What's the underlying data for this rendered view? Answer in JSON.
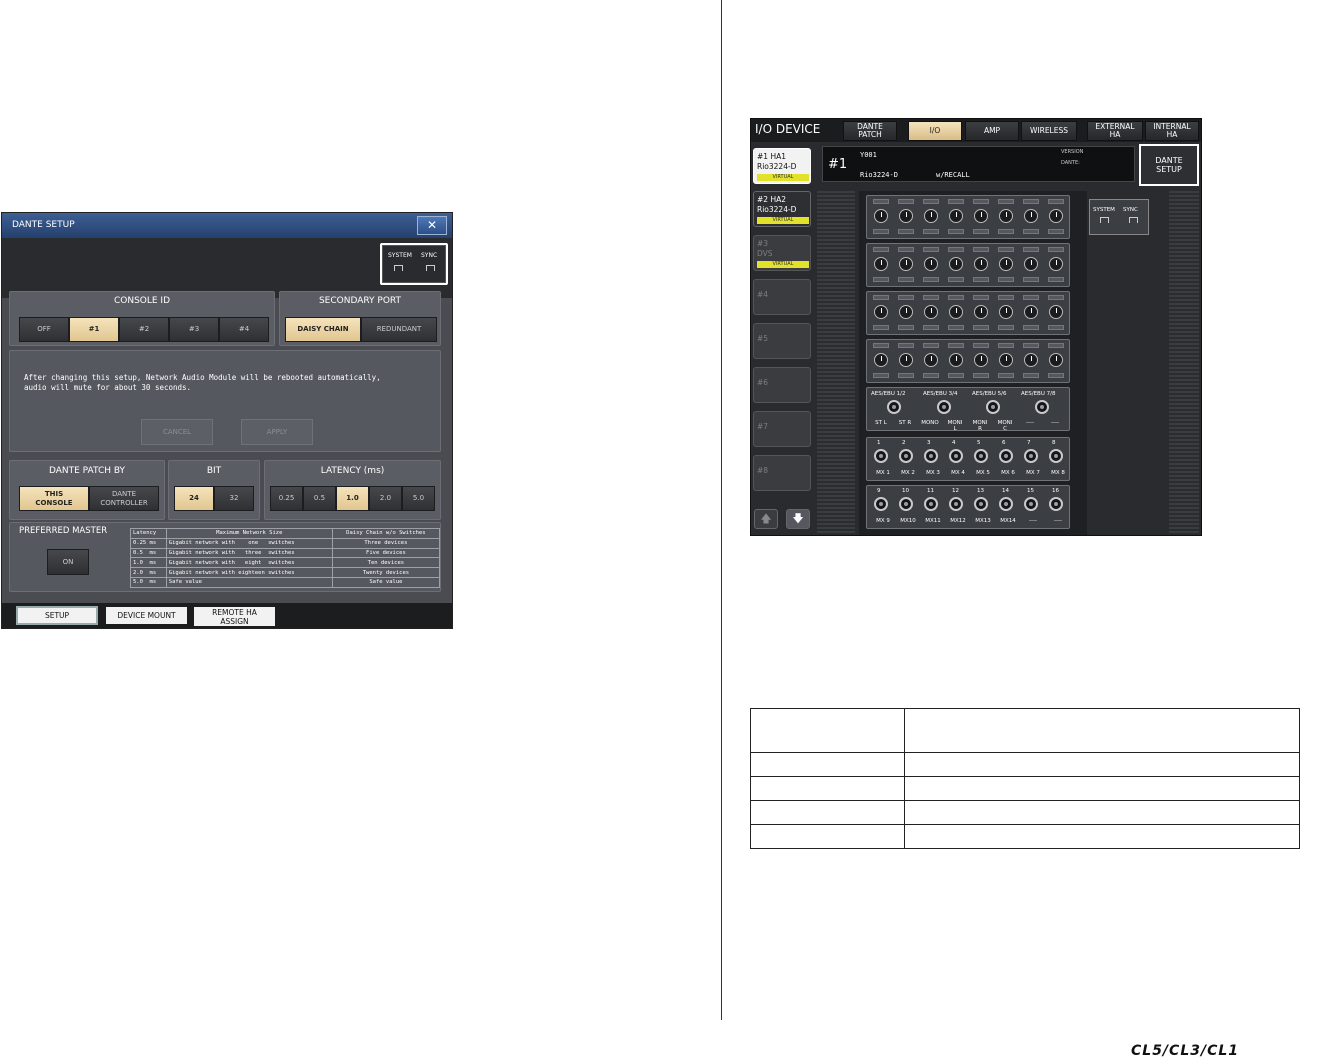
{
  "dante_setup": {
    "title": "DANTE SETUP",
    "close_symbol": "✕",
    "sync": {
      "system": "SYSTEM",
      "sync": "SYNC"
    },
    "console_id": {
      "title": "CONSOLE ID",
      "options": [
        "OFF",
        "#1",
        "#2",
        "#3",
        "#4"
      ],
      "selected": "#1"
    },
    "secondary_port": {
      "title": "SECONDARY PORT",
      "options": [
        "DAISY CHAIN",
        "REDUNDANT"
      ],
      "selected": "DAISY CHAIN"
    },
    "note": "After changing this setup, Network Audio Module will be rebooted automatically,\naudio will mute for about 30 seconds.",
    "cancel": "CANCEL",
    "apply": "APPLY",
    "dante_patch_by": {
      "title": "DANTE PATCH BY",
      "options": [
        "THIS\nCONSOLE",
        "DANTE\nCONTROLLER"
      ],
      "selected": "THIS\nCONSOLE"
    },
    "bit": {
      "title": "BIT",
      "options": [
        "24",
        "32"
      ],
      "selected": "24"
    },
    "latency": {
      "title": "LATENCY (ms)",
      "options": [
        "0.25",
        "0.5",
        "1.0",
        "2.0",
        "5.0"
      ],
      "selected": "1.0"
    },
    "preferred_master": {
      "title": "PREFERRED MASTER",
      "button": "ON"
    },
    "latency_table": {
      "headers": [
        "Latency",
        "Maximum Network Size",
        "Daisy Chain w/o Switches"
      ],
      "rows": [
        [
          "0.25 ms",
          "Gigabit network with    one   switches",
          "Three devices"
        ],
        [
          "0.5  ms",
          "Gigabit network with   three  switches",
          "Five devices"
        ],
        [
          "1.0  ms",
          "Gigabit network with   eight  switches",
          "Ten devices"
        ],
        [
          "2.0  ms",
          "Gigabit network with eighteen switches",
          "Twenty devices"
        ],
        [
          "5.0  ms",
          "Safe value",
          "Safe value"
        ]
      ]
    },
    "tabs": [
      "SETUP",
      "DEVICE MOUNT",
      "REMOTE HA\nASSIGN"
    ],
    "active_tab": "SETUP"
  },
  "io_device": {
    "title": "I/O DEVICE",
    "tabs": [
      "DANTE\nPATCH",
      "I/O",
      "AMP",
      "WIRELESS",
      "EXTERNAL\nHA",
      "INTERNAL\nHA"
    ],
    "active_tab": "I/O",
    "devices": [
      {
        "label": "#1 HA1\nRio3224-D",
        "tag": "VIRTUAL"
      },
      {
        "label": "#2 HA2\nRio3224-D",
        "tag": "VIRTUAL"
      },
      {
        "label": "#3\nDVS",
        "tag": "VIRTUAL"
      },
      {
        "label": "#4",
        "tag": ""
      },
      {
        "label": "#5",
        "tag": ""
      },
      {
        "label": "#6",
        "tag": ""
      },
      {
        "label": "#7",
        "tag": ""
      },
      {
        "label": "#8",
        "tag": ""
      }
    ],
    "info": {
      "id": "#1",
      "model_top": "Y001",
      "model": "Rio3224-D",
      "recall": "w/RECALL",
      "version": "VERSION",
      "dante": "DANTE:"
    },
    "dante_setup_button": "DANTE\nSETUP",
    "sync": {
      "system": "SYSTEM",
      "sync": "SYNC"
    },
    "aes": {
      "titles": [
        "AES/EBU 1/2",
        "AES/EBU 3/4",
        "AES/EBU 5/6",
        "AES/EBU 7/8"
      ],
      "labels": [
        "ST L",
        "ST R",
        "MONO",
        "MONI\nL",
        "MONI\nR",
        "MONI\nC",
        "----",
        "----"
      ]
    },
    "outputs_a": {
      "numbers": [
        "1",
        "2",
        "3",
        "4",
        "5",
        "6",
        "7",
        "8"
      ],
      "labels": [
        "MX 1",
        "MX 2",
        "MX 3",
        "MX 4",
        "MX 5",
        "MX 6",
        "MX 7",
        "MX 8"
      ]
    },
    "outputs_b": {
      "numbers": [
        "9",
        "10",
        "11",
        "12",
        "13",
        "14",
        "15",
        "16"
      ],
      "labels": [
        "MX 9",
        "MX10",
        "MX11",
        "MX12",
        "MX13",
        "MX14",
        "----",
        "----"
      ]
    },
    "arrows": {
      "up": "🡅",
      "down": "🡇"
    }
  },
  "logo": "CL5/CL3/CL1"
}
